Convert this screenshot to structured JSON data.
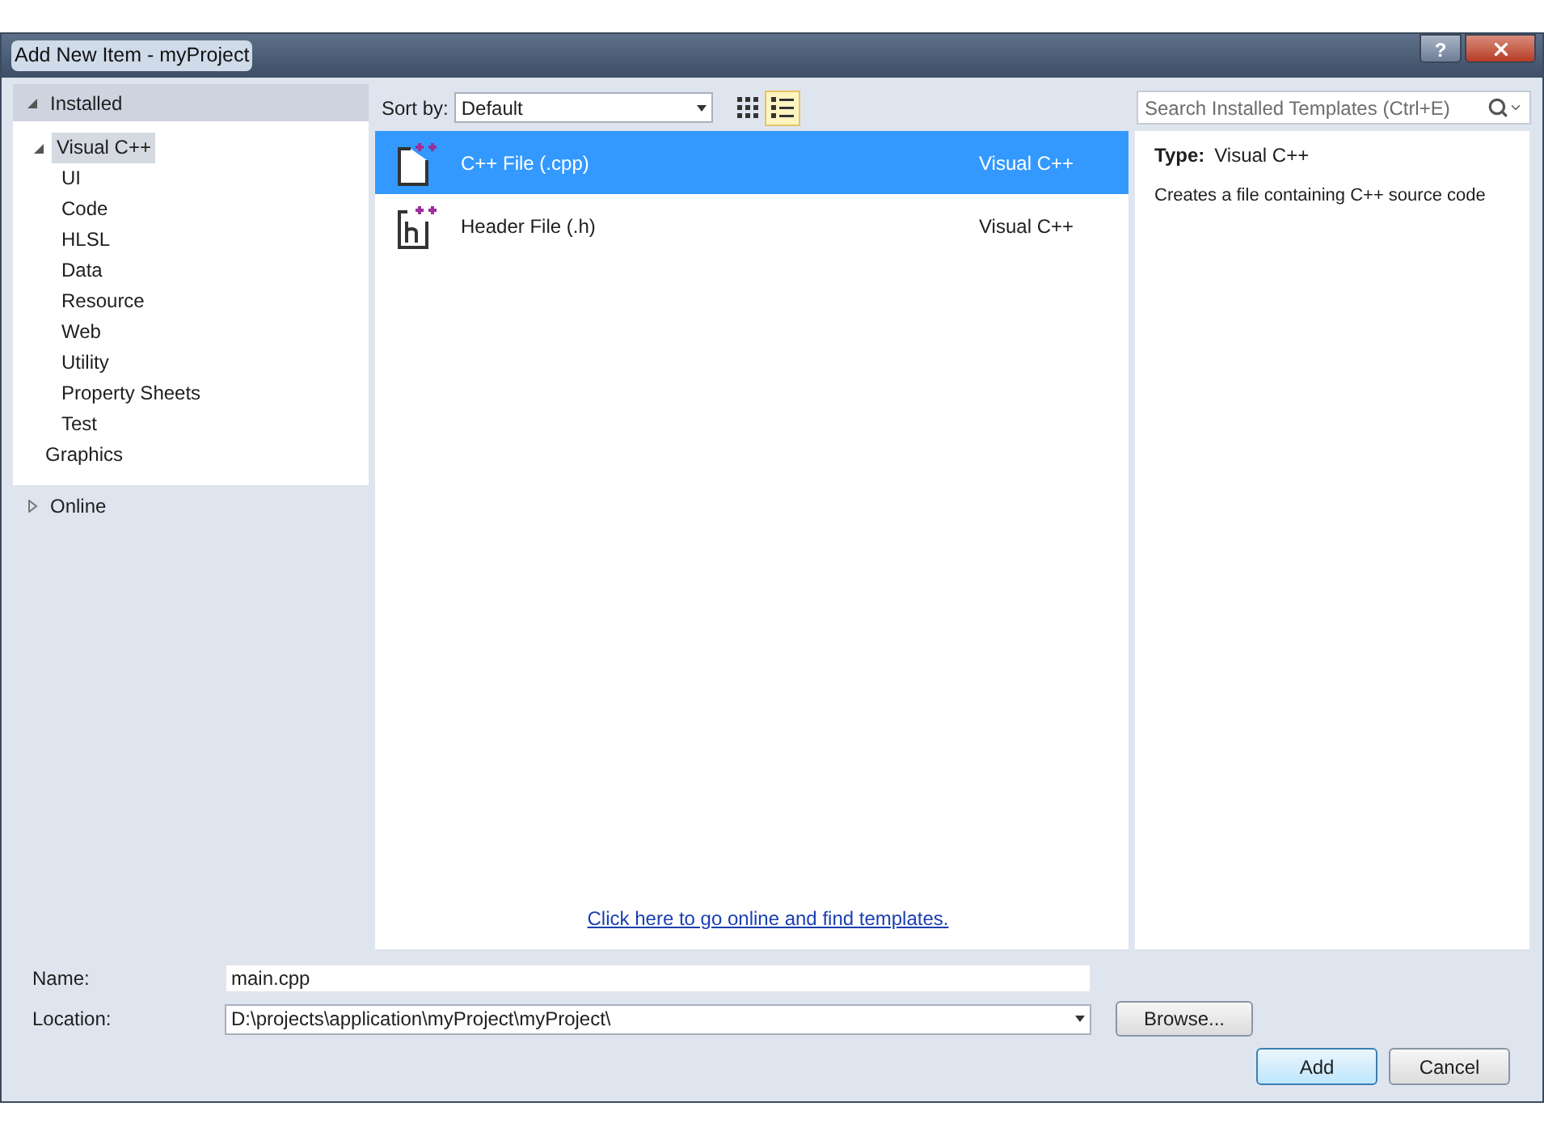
{
  "window": {
    "title": "Add New Item - myProject",
    "help_button": "?"
  },
  "sidebar": {
    "tree": [
      {
        "label": "Installed",
        "expanded": true,
        "children": [
          {
            "label": "Visual C++",
            "expanded": true,
            "selected": true,
            "children": [
              {
                "label": "UI",
                "selected": false
              },
              {
                "label": "Code",
                "selected": false
              },
              {
                "label": "HLSL",
                "selected": false
              },
              {
                "label": "Data",
                "selected": false
              },
              {
                "label": "Resource",
                "selected": false
              },
              {
                "label": "Web",
                "selected": false
              },
              {
                "label": "Utility",
                "selected": false
              },
              {
                "label": "Property Sheets",
                "selected": false
              },
              {
                "label": "Test",
                "selected": false
              }
            ]
          },
          {
            "label": "Graphics",
            "selected": false
          }
        ]
      },
      {
        "label": "Online",
        "expanded": false
      }
    ]
  },
  "toolbar": {
    "sort_label": "Sort by:",
    "sort_value": "Default",
    "view_buttons": [
      {
        "kind": "grid",
        "selected": false
      },
      {
        "kind": "list",
        "selected": true
      }
    ]
  },
  "search": {
    "placeholder": "Search Installed Templates (Ctrl+E)"
  },
  "templates": [
    {
      "name": "C++ File (.cpp)",
      "language": "Visual C++",
      "kind": "cpp",
      "selected": true
    },
    {
      "name": "Header File (.h)",
      "language": "Visual C++",
      "kind": "header",
      "selected": false
    }
  ],
  "online_link": "Click here to go online and find templates.",
  "details": {
    "type_label": "Type:",
    "type_value": "Visual C++",
    "description": "Creates a file containing C++ source code"
  },
  "form": {
    "name_label": "Name:",
    "name_value": "main.cpp",
    "location_label": "Location:",
    "location_value": "D:\\projects\\application\\myProject\\myProject\\",
    "browse": "Browse..."
  },
  "buttons": [
    {
      "label": "Add",
      "default": true
    },
    {
      "label": "Cancel",
      "default": false
    }
  ]
}
